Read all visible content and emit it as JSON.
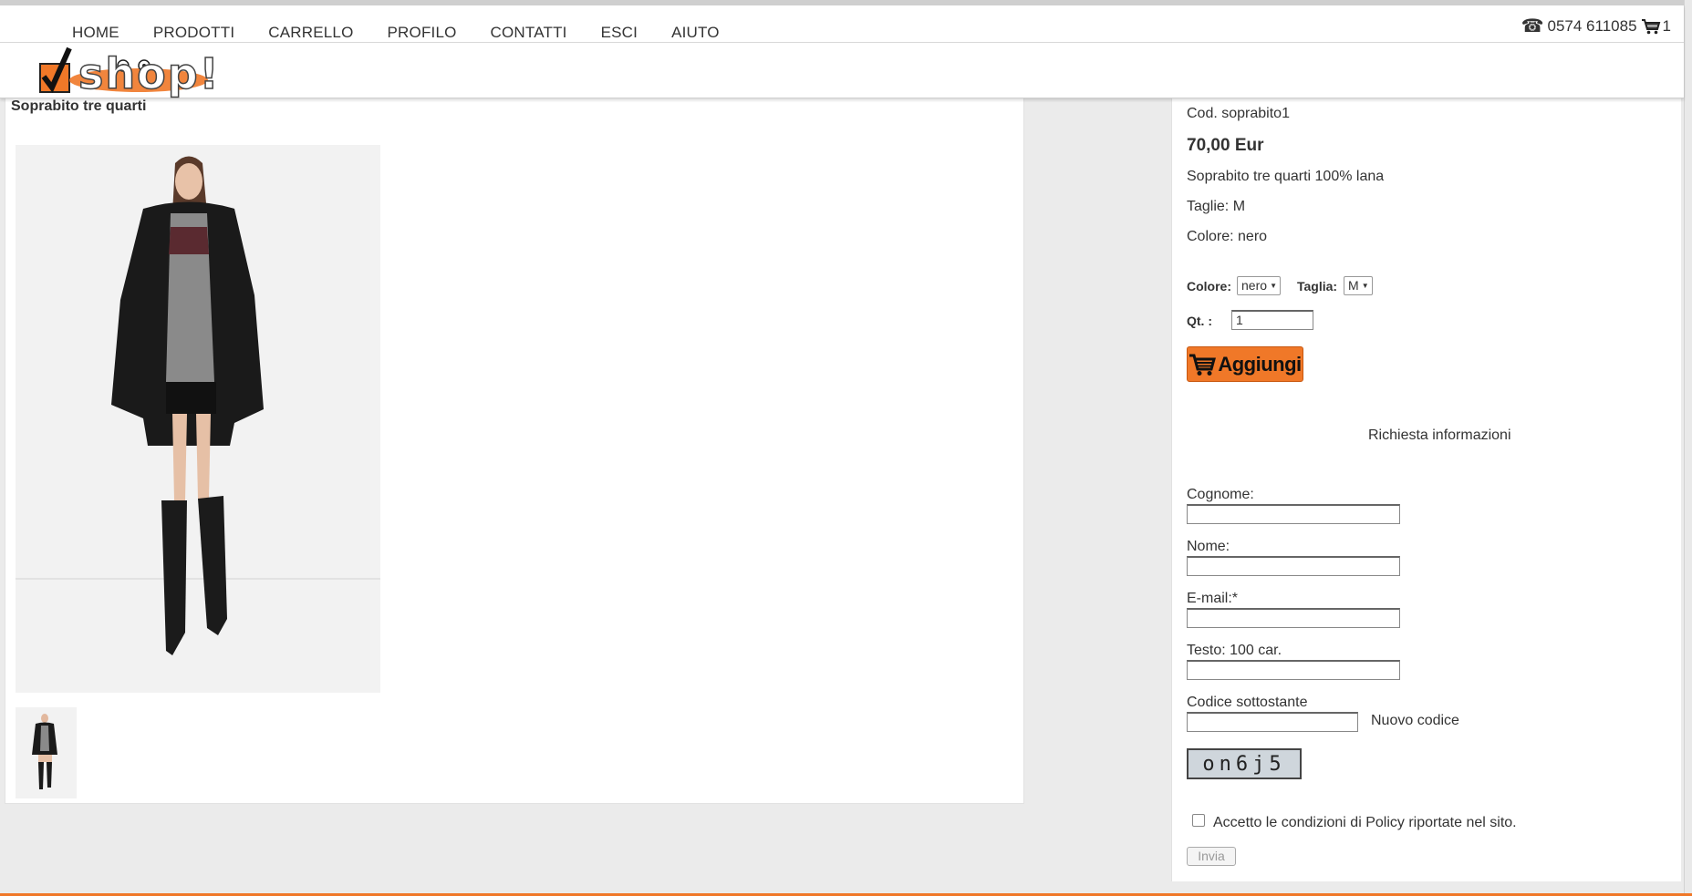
{
  "nav": {
    "items": [
      "HOME",
      "PRODOTTI",
      "CARRELLO",
      "PROFILO",
      "CONTATTI",
      "ESCI",
      "AIUTO"
    ]
  },
  "contact": {
    "phone": "0574 611085",
    "cart_count": "1"
  },
  "logo": {
    "text": "shop!",
    "icon": "checkmark-box-icon"
  },
  "product": {
    "title": "Soprabito tre quarti",
    "code": "Cod. soprabito1",
    "price": "70,00 Eur",
    "description": "Soprabito tre quarti 100% lana",
    "sizes": "Taglie: M",
    "color": "Colore: nero"
  },
  "options": {
    "color_label": "Colore:",
    "color_value": "nero",
    "size_label": "Taglia:",
    "size_value": "M",
    "qty_label": "Qt. :",
    "qty_value": "1"
  },
  "add_button": {
    "label": "Aggiungi",
    "icon": "shopping-cart-icon"
  },
  "info_form": {
    "title": "Richiesta informazioni",
    "cognome_label": "Cognome:",
    "nome_label": "Nome:",
    "email_label": "E-mail:*",
    "testo_label": "Testo: 100 car.",
    "codice_label": "Codice sottostante",
    "new_code_link": "Nuovo codice",
    "captcha_text": "on6j5",
    "policy_text": "Accetto le condizioni di Policy riportate nel sito.",
    "submit_label": "Invia"
  },
  "colors": {
    "accent": "#f07828",
    "page_bg": "#ebebeb"
  }
}
